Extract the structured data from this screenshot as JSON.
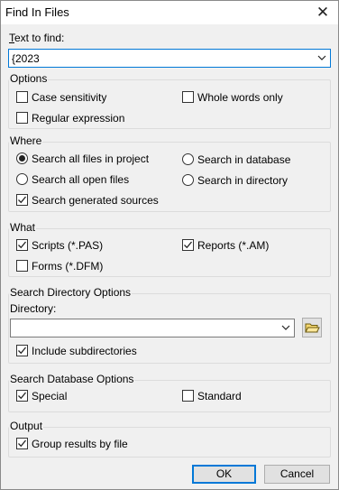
{
  "window": {
    "title": "Find In Files",
    "close_glyph": "✕"
  },
  "find": {
    "label": "Text to find:",
    "value": "{2023"
  },
  "options": {
    "title": "Options",
    "case_sensitivity": {
      "label": "Case sensitivity",
      "checked": false
    },
    "whole_words_only": {
      "label": "Whole words only",
      "checked": false
    },
    "regular_expression": {
      "label": "Regular expression",
      "checked": false
    }
  },
  "where": {
    "title": "Where",
    "search_all_files_in_project": {
      "label": "Search all files in project",
      "selected": true
    },
    "search_all_open_files": {
      "label": "Search all open files",
      "selected": false
    },
    "search_in_database": {
      "label": "Search in database",
      "selected": false
    },
    "search_in_directory": {
      "label": "Search in directory",
      "selected": false
    },
    "search_generated_sources": {
      "label": "Search generated sources",
      "checked": true
    }
  },
  "what": {
    "title": "What",
    "scripts": {
      "label": "Scripts (*.PAS)",
      "checked": true
    },
    "reports": {
      "label": "Reports (*.AM)",
      "checked": true
    },
    "forms": {
      "label": "Forms (*.DFM)",
      "checked": false
    }
  },
  "search_directory_options": {
    "title": "Search Directory Options",
    "directory_label": "Directory:",
    "directory_value": "",
    "include_subdirectories": {
      "label": "Include subdirectories",
      "checked": true
    }
  },
  "search_database_options": {
    "title": "Search Database Options",
    "special": {
      "label": "Special",
      "checked": true
    },
    "standard": {
      "label": "Standard",
      "checked": false
    }
  },
  "output": {
    "title": "Output",
    "group_results_by_file": {
      "label": "Group results by file",
      "checked": true
    }
  },
  "buttons": {
    "ok": "OK",
    "cancel": "Cancel"
  },
  "icons": {
    "combo_arrow": "chevron-down-icon",
    "folder": "folder-icon",
    "close": "close-icon"
  }
}
